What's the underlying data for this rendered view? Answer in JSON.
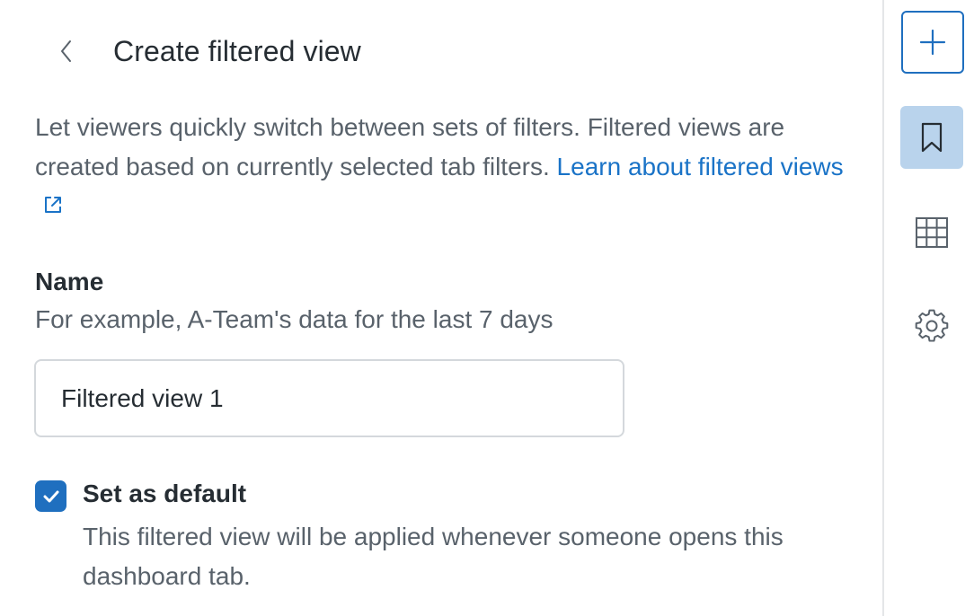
{
  "header": {
    "title": "Create filtered view",
    "back_icon": "chevron-left-icon"
  },
  "description": {
    "text": "Let viewers quickly switch between sets of filters. Filtered views are created based on currently selected tab filters. ",
    "link_text": "Learn about filtered views",
    "link_icon": "external-link-icon"
  },
  "name_field": {
    "label": "Name",
    "hint": "For example, A-Team's data for the last 7 days",
    "value": "Filtered view 1"
  },
  "default_option": {
    "checked": true,
    "label": "Set as default",
    "description": "This filtered view will be applied whenever someone opens this dashboard tab."
  },
  "rail": {
    "items": [
      {
        "icon": "plus-icon",
        "active": false
      },
      {
        "icon": "bookmark-icon",
        "active": true
      },
      {
        "icon": "table-grid-icon",
        "active": false
      },
      {
        "icon": "gear-icon",
        "active": false
      }
    ]
  },
  "colors": {
    "accent": "#1f6fbf",
    "link": "#1a73c7",
    "active_bg": "#b9d3ec",
    "text_primary": "#262d33",
    "text_secondary": "#59626b"
  }
}
